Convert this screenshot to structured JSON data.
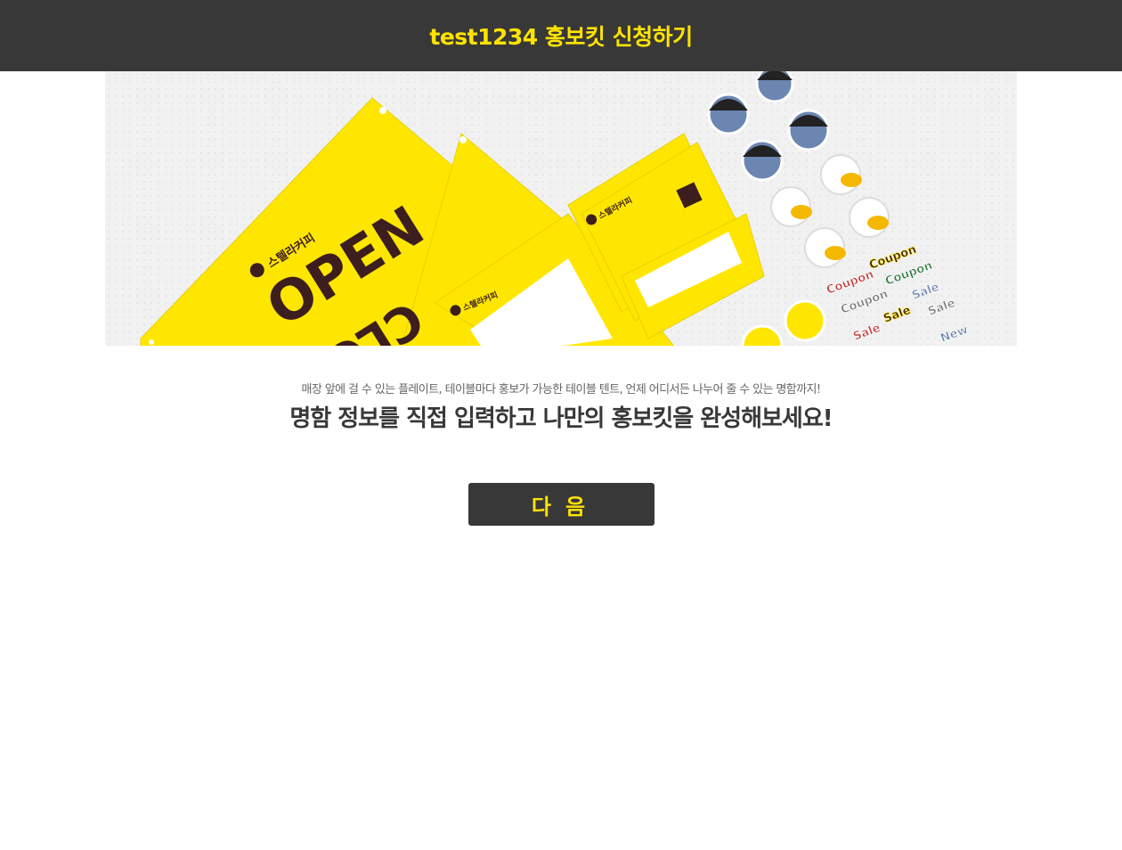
{
  "header": {
    "title": "test1234 홍보킷 신청하기"
  },
  "banner": {
    "plate_open": "OPEN",
    "plate_closed": "CLOSED",
    "brand": "스텔라커피",
    "stickers": [
      "Coupon",
      "Coupon",
      "Coupon",
      "Coupon",
      "Sale",
      "Sale",
      "Sale",
      "Sale",
      "New"
    ],
    "colors": {
      "yellow": "#ffe600",
      "dark_brown": "#3c1e1e",
      "background": "#f1f1f1"
    }
  },
  "intro": {
    "subtitle": "매장 앞에 걸 수 있는 플레이트, 테이블마다 홍보가 가능한 테이블 텐트, 언제 어디서든 나누어 줄 수 있는 명함까지!",
    "headline": "명함 정보를 직접 입력하고 나만의 홍보킷을 완성해보세요!"
  },
  "actions": {
    "next_label": "다음"
  },
  "theme": {
    "accent": "#ffe300",
    "dark": "#383838"
  }
}
